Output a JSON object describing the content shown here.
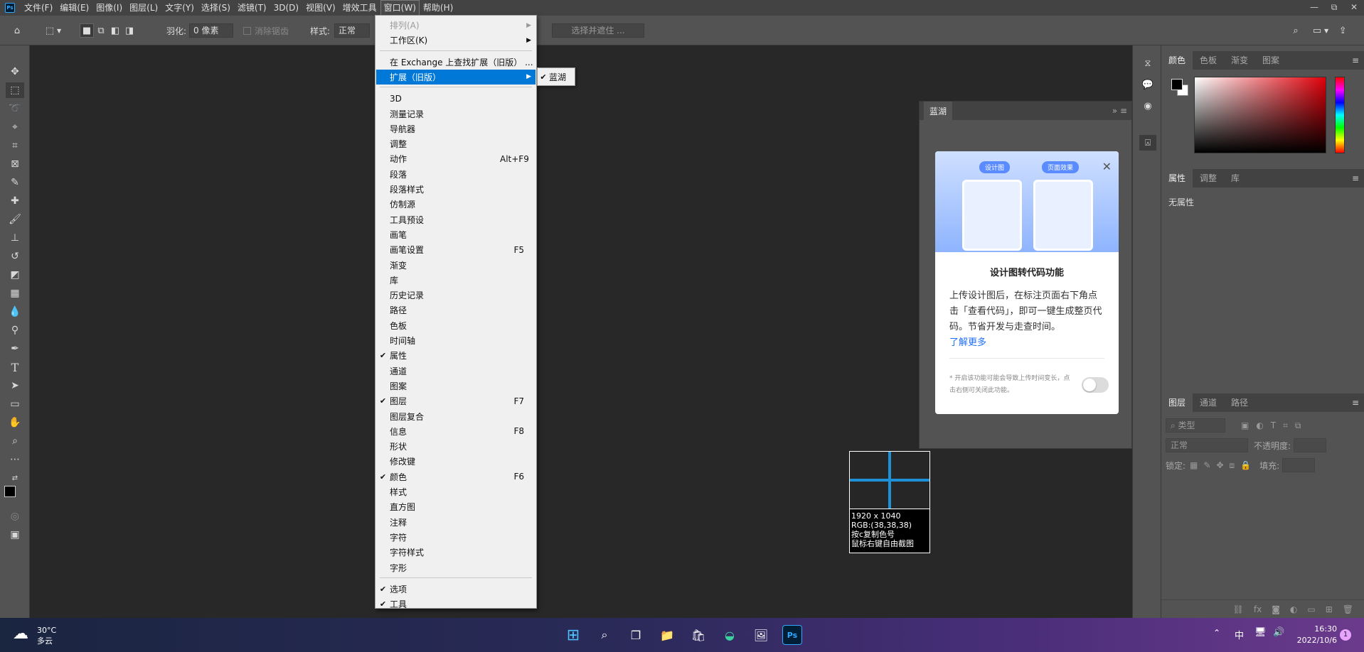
{
  "menubar": {
    "items": [
      "文件(F)",
      "编辑(E)",
      "图像(I)",
      "图层(L)",
      "文字(Y)",
      "选择(S)",
      "滤镜(T)",
      "3D(D)",
      "视图(V)",
      "增效工具",
      "窗口(W)",
      "帮助(H)"
    ],
    "active_index": 10,
    "win_controls": [
      "—",
      "⧉",
      "✕"
    ]
  },
  "options_bar": {
    "feather_label": "羽化:",
    "feather_value": "0 像素",
    "antialias_label": "消除锯齿",
    "style_label": "样式:",
    "style_value": "正常",
    "select_mask_button": "选择并遮住 ..."
  },
  "window_menu": {
    "items": [
      {
        "label": "排列(A)",
        "disabled": true,
        "submenu": true
      },
      {
        "label": "工作区(K)",
        "submenu": true
      },
      {
        "sep": true
      },
      {
        "label": "在 Exchange 上查找扩展（旧版） ..."
      },
      {
        "label": "扩展（旧版）",
        "highlight": true,
        "submenu": true
      },
      {
        "sep": true
      },
      {
        "label": "3D"
      },
      {
        "label": "测量记录"
      },
      {
        "label": "导航器"
      },
      {
        "label": "调整"
      },
      {
        "label": "动作",
        "shortcut": "Alt+F9"
      },
      {
        "label": "段落"
      },
      {
        "label": "段落样式"
      },
      {
        "label": "仿制源"
      },
      {
        "label": "工具预设"
      },
      {
        "label": "画笔"
      },
      {
        "label": "画笔设置",
        "shortcut": "F5"
      },
      {
        "label": "渐变"
      },
      {
        "label": "库"
      },
      {
        "label": "历史记录"
      },
      {
        "label": "路径"
      },
      {
        "label": "色板"
      },
      {
        "label": "时间轴"
      },
      {
        "label": "属性",
        "checked": true
      },
      {
        "label": "通道"
      },
      {
        "label": "图案"
      },
      {
        "label": "图层",
        "checked": true,
        "shortcut": "F7"
      },
      {
        "label": "图层复合"
      },
      {
        "label": "信息",
        "shortcut": "F8"
      },
      {
        "label": "形状"
      },
      {
        "label": "修改键"
      },
      {
        "label": "颜色",
        "checked": true,
        "shortcut": "F6"
      },
      {
        "label": "样式"
      },
      {
        "label": "直方图"
      },
      {
        "label": "注释"
      },
      {
        "label": "字符"
      },
      {
        "label": "字符样式"
      },
      {
        "label": "字形"
      },
      {
        "sep": true
      },
      {
        "label": "选项",
        "checked": true
      },
      {
        "label": "工具",
        "checked": true
      }
    ]
  },
  "submenu": {
    "label": "蓝湖",
    "checked": true
  },
  "lanhu_panel": {
    "title": "蓝湖",
    "badge_left": "设计图",
    "badge_right": "页面效果",
    "card_title": "设计图转代码功能",
    "card_body": "上传设计图后，在标注页面右下角点击「查看代码」，即可一键生成整页代码。节省开发与走查时间。",
    "learn_more": "了解更多",
    "note": "* 开启该功能可能会导致上传时间变长，点击右侧可关闭此功能。",
    "toggle_on": false
  },
  "snip_tooltip": {
    "size": "1920 x 1040",
    "rgb": "RGB:(38,38,38)",
    "hint1": "按c复制色号",
    "hint2": "鼠标右键自由截图"
  },
  "right_panels": {
    "color_tabs": [
      "颜色",
      "色板",
      "渐变",
      "图案"
    ],
    "props_tabs": [
      "属性",
      "调整",
      "库"
    ],
    "props_empty": "无属性",
    "layers_tabs": [
      "图层",
      "通道",
      "路径"
    ],
    "layers_search": "类型",
    "blend_mode": "正常",
    "opacity_label": "不透明度:",
    "lock_label": "锁定:",
    "fill_label": "填充:"
  },
  "taskbar": {
    "weather_temp": "30°C",
    "weather_desc": "多云",
    "ime": "中",
    "time": "16:30",
    "date": "2022/10/6",
    "notif_count": "1",
    "ps_label": "Ps"
  },
  "colors": {
    "menu_highlight": "#0078d7",
    "panel_bg": "#535353",
    "canvas_bg": "#282828",
    "snip_cross": "#1e90d8"
  },
  "icons": [
    "home-icon",
    "marquee-icon",
    "move-icon",
    "lasso-icon",
    "crop-icon",
    "brush-icon",
    "eraser-icon",
    "pen-icon",
    "type-icon",
    "hand-icon",
    "zoom-icon",
    "search-icon"
  ]
}
